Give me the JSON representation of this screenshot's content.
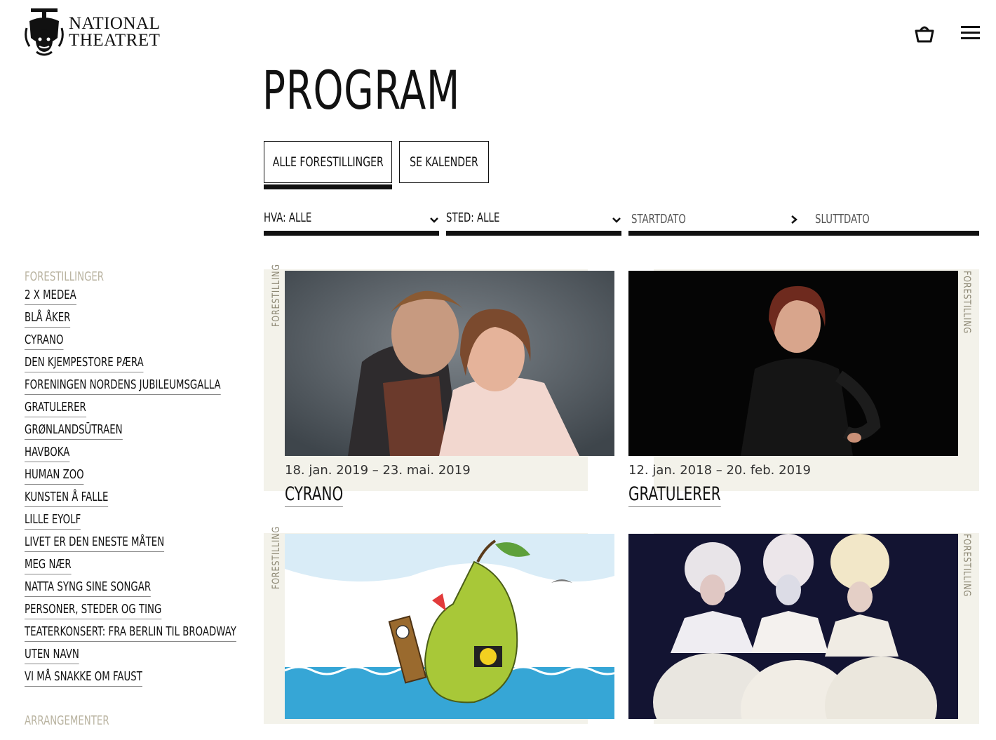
{
  "header": {
    "logo_line1": "NATIONAL",
    "logo_line2": "THEATRET",
    "cart_icon": "basket-icon",
    "menu_icon": "hamburger-icon"
  },
  "page": {
    "title": "PROGRAM"
  },
  "tabs": {
    "all_label": "ALLE FORESTILLINGER",
    "calendar_label": "SE KALENDER",
    "active": "ALLE FORESTILLINGER"
  },
  "filters": {
    "hva_label": "HVA: ALLE",
    "sted_label": "STED: ALLE",
    "start_placeholder": "STARTDATO",
    "end_placeholder": "SLUTTDATO"
  },
  "sidebar": {
    "heading": "FORESTILLINGER",
    "items": [
      "2 X MEDEA",
      "BLÅ ÅKER",
      "CYRANO",
      "DEN KJEMPESTORE PÆRA",
      "FORENINGEN NORDENS JUBILEUMSGALLA",
      "GRATULERER",
      "GRØNLANDSŪTRAEN",
      "HAVBOKA",
      "HUMAN ZOO",
      "KUNSTEN Å FALLE",
      "LILLE EYOLF",
      "LIVET ER DEN ENESTE MÅTEN",
      "MEG NÆR",
      "NATTA SYNG SINE SONGAR",
      "PERSONER, STEDER OG TING",
      "TEATERKONSERT: FRA BERLIN TIL BROADWAY",
      "UTEN NAVN",
      "VI MÅ SNAKKE OM FAUST"
    ],
    "heading2": "ARRANGEMENTER"
  },
  "cards": [
    {
      "type_label": "FORESTILLING",
      "dates": "18. jan. 2019 – 23. mai. 2019",
      "title": "CYRANO"
    },
    {
      "type_label": "FORESTILLING",
      "dates": "12. jan. 2018 – 20. feb. 2019",
      "title": "GRATULERER"
    },
    {
      "type_label": "FORESTILLING",
      "dates": "",
      "title": ""
    },
    {
      "type_label": "FORESTILLING",
      "dates": "",
      "title": ""
    }
  ],
  "colors": {
    "accent": "#111111",
    "card_bg": "#f3f2ea",
    "muted": "#b9b3a0"
  }
}
